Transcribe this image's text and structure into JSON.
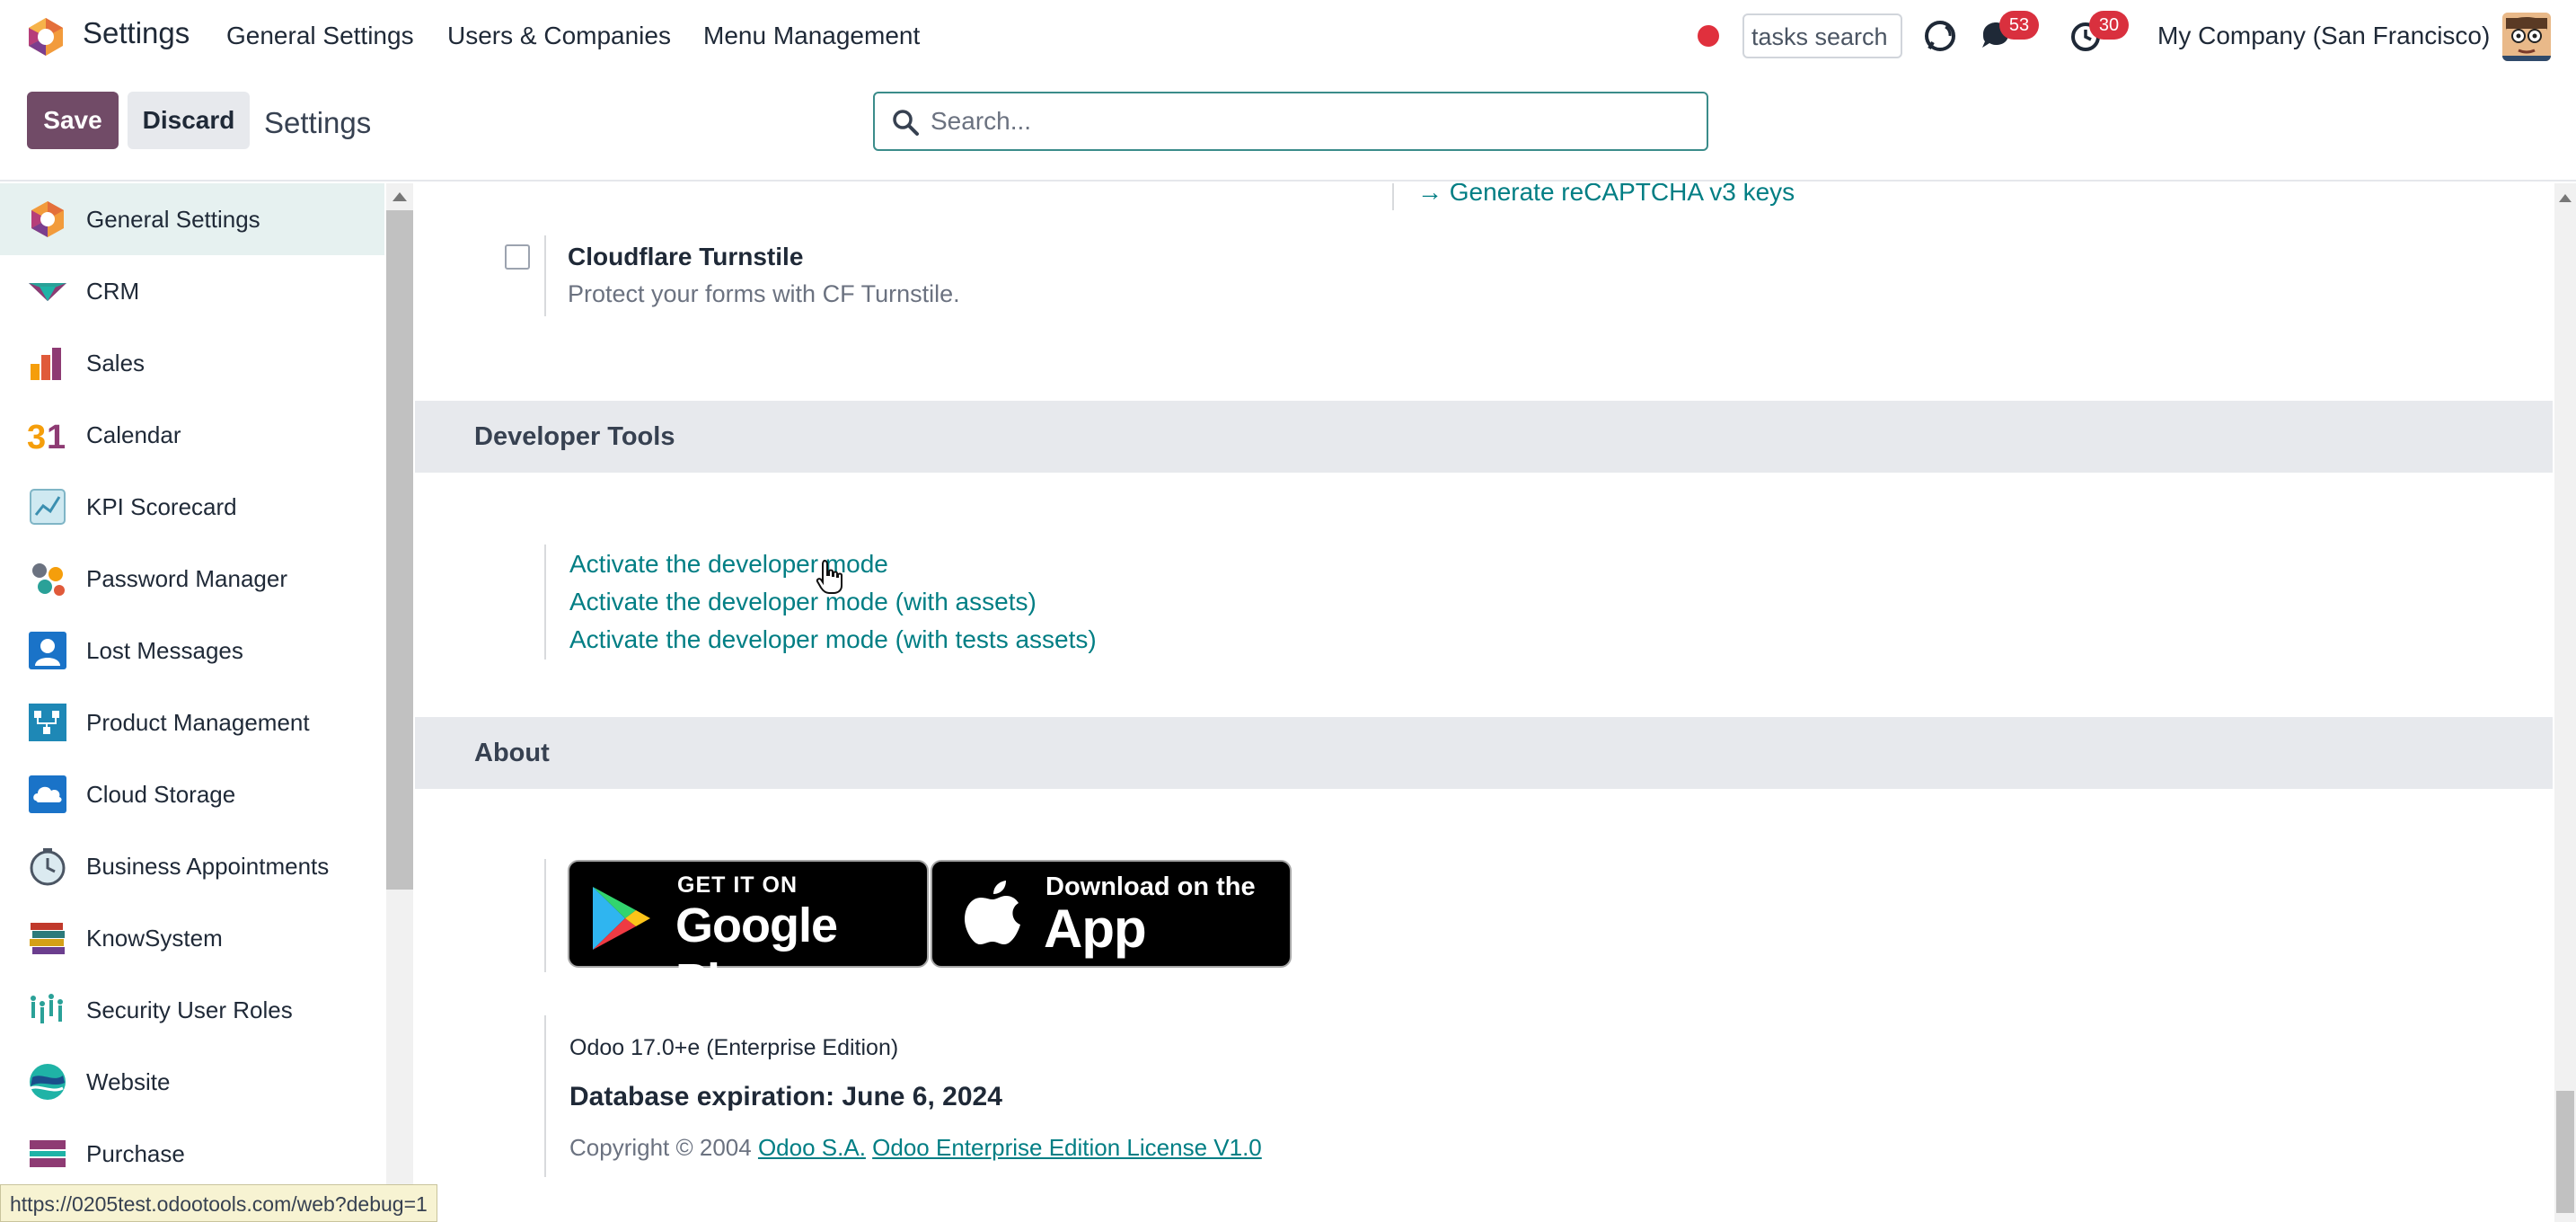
{
  "topbar": {
    "app_title": "Settings",
    "menu": [
      "General Settings",
      "Users & Companies",
      "Menu Management"
    ],
    "tasks_search": "tasks search",
    "messages_count": "53",
    "activities_count": "30",
    "company": "My Company (San Francisco)"
  },
  "controls": {
    "save_label": "Save",
    "discard_label": "Discard",
    "breadcrumb": "Settings",
    "search_placeholder": "Search..."
  },
  "sidebar": {
    "items": [
      {
        "label": "General Settings",
        "icon": "odoo-logo-icon",
        "active": true
      },
      {
        "label": "CRM",
        "icon": "crm-icon"
      },
      {
        "label": "Sales",
        "icon": "sales-icon"
      },
      {
        "label": "Calendar",
        "icon": "calendar-icon"
      },
      {
        "label": "KPI Scorecard",
        "icon": "kpi-scorecard-icon"
      },
      {
        "label": "Password Manager",
        "icon": "password-manager-icon"
      },
      {
        "label": "Lost Messages",
        "icon": "lost-messages-icon"
      },
      {
        "label": "Product Management",
        "icon": "product-management-icon"
      },
      {
        "label": "Cloud Storage",
        "icon": "cloud-storage-icon"
      },
      {
        "label": "Business Appointments",
        "icon": "business-appointments-icon"
      },
      {
        "label": "KnowSystem",
        "icon": "knowsystem-icon"
      },
      {
        "label": "Security User Roles",
        "icon": "security-user-roles-icon"
      },
      {
        "label": "Website",
        "icon": "website-icon"
      },
      {
        "label": "Purchase",
        "icon": "purchase-icon"
      }
    ]
  },
  "content": {
    "recaptcha_link": "Generate reCAPTCHA v3 keys",
    "turnstile_title": "Cloudflare Turnstile",
    "turnstile_desc": "Protect your forms with CF Turnstile.",
    "developer_tools_title": "Developer Tools",
    "dev_links": [
      "Activate the developer mode",
      "Activate the developer mode (with assets)",
      "Activate the developer mode (with tests assets)"
    ],
    "about_title": "About",
    "google_play_small": "GET IT ON",
    "google_play_big": "Google Play",
    "app_store_small": "Download on the",
    "app_store_big": "App Store",
    "version": "Odoo 17.0+e (Enterprise Edition)",
    "expiration": "Database expiration: June 6, 2024",
    "copyright": "Copyright © 2004",
    "odoo_sa_link": "Odoo S.A.",
    "license_link": "Odoo Enterprise Edition License V1.0"
  },
  "status_url": "https://0205test.odootools.com/web?debug=1",
  "colors": {
    "brand": "#714b67",
    "link": "#017e84",
    "badge": "#d9303e",
    "section_bg": "#e7e9ed"
  }
}
